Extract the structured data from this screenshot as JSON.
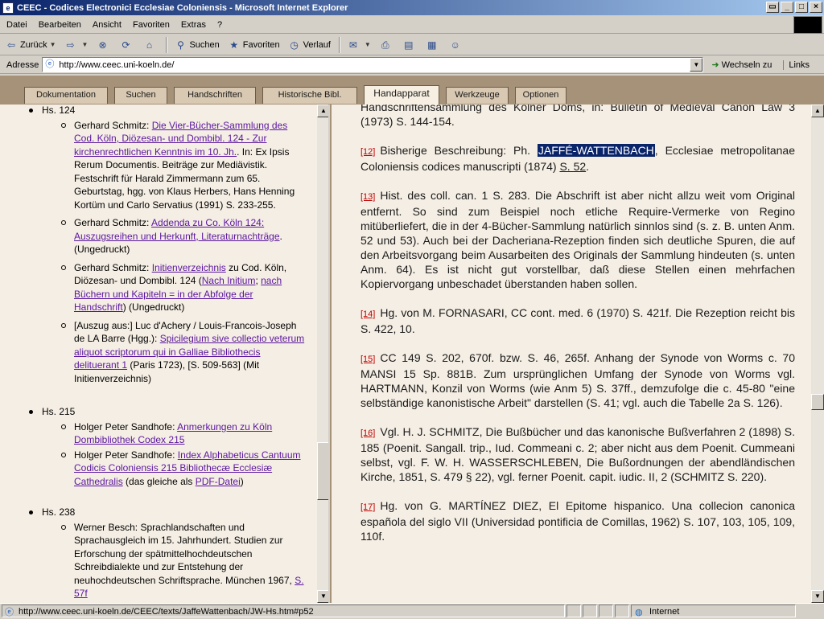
{
  "window": {
    "title": "CEEC - Codices Electronici Ecclesiae Coloniensis - Microsoft Internet Explorer"
  },
  "menu": [
    "Datei",
    "Bearbeiten",
    "Ansicht",
    "Favoriten",
    "Extras",
    "?"
  ],
  "toolbar": {
    "back": "Zurück",
    "search": "Suchen",
    "favorites": "Favoriten",
    "history": "Verlauf"
  },
  "address": {
    "label": "Adresse",
    "url": "http://www.ceec.uni-koeln.de/",
    "go": "Wechseln zu",
    "links": "Links"
  },
  "tabs": [
    "Dokumentation",
    "Suchen",
    "Handschriften",
    "Historische Bibl.",
    "Handapparat",
    "Werkzeuge",
    "Optionen"
  ],
  "active_tab": "Handapparat",
  "left": {
    "hs124": {
      "label": "Hs. 124",
      "e1": {
        "pre": "Gerhard Schmitz: ",
        "link": "Die Vier-Bücher-Sammlung des Cod. Köln, Diözesan- und Dombibl. 124 - Zur kirchenrechtlichen Kenntnis im 10. Jh.",
        "post": ". In: Ex Ipsis Rerum Documentis. Beiträge zur Mediävistik. Festschrift für Harald Zimmermann zum 65. Geburtstag, hgg. von Klaus Herbers, Hans Henning Kortüm und Carlo Servatius (1991) S. 233-255."
      },
      "e2": {
        "pre": "Gerhard Schmitz: ",
        "link": "Addenda zu Co. Köln 124: Auszugsreihen und Herkunft, Literaturnachträge",
        "post": ". (Ungedruckt)"
      },
      "e3": {
        "pre": "Gerhard Schmitz: ",
        "link": "Initienverzeichnis",
        "mid": " zu Cod. Köln, Diözesan- und Dombibl. 124 (",
        "link2": "Nach Initium",
        "sep": "; ",
        "link3": "nach Büchern und Kapiteln = in der Abfolge der Handschrift",
        "post": ") (Ungedruckt)"
      },
      "e4": {
        "pre": "[Auszug aus:] Luc d'Achery / Louis-Francois-Joseph de LA Barre (Hgg.): ",
        "link": "Spicilegium sive collectio veterum aliquot scriptorum qui in Galliae Bibliothecis delituerant 1",
        "post": " (Paris 1723), [S. 509-563] (Mit Initienverzeichnis)"
      }
    },
    "hs215": {
      "label": "Hs. 215",
      "e1": {
        "pre": "Holger Peter Sandhofe: ",
        "link": "Anmerkungen zu Köln Dombibliothek Codex 215"
      },
      "e2": {
        "pre": "Holger Peter Sandhofe: ",
        "link": "Index Alphabeticus Cantuum Codicis Coloniensis 215 Bibliothecæ Ecclesiæ Cathedralis",
        "mid": " (das gleiche als ",
        "link2": "PDF-Datei",
        "post": ")"
      }
    },
    "hs238": {
      "label": "Hs. 238",
      "e1": {
        "pre": "Werner Besch: Sprachlandschaften und Sprachausgleich im 15. Jahrhundert. Studien zur Erforschung der spätmittelhochdeutschen Schreibdialekte und zur Entstehung der neuhochdeutschen Schriftsprache. München 1967, ",
        "link": "S. 57f"
      }
    }
  },
  "right": {
    "top": "Handschriftensammlung des Kölner Doms, in: Bulletin of Medieval Canon Law 3 (1973) S. 144-154.",
    "fn12": {
      "num": "[12]",
      "pre": "Bisherige Beschreibung: Ph. ",
      "hl": "JAFFÉ-WATTENBACH",
      "post": ", Ecclesiae metropolitanae Coloniensis codices manuscripti (1874) ",
      "link": "S. 52",
      "end": "."
    },
    "fn13": {
      "num": "[13]",
      "text": "Hist. des coll. can. 1 S. 283. Die Abschrift ist aber nicht allzu weit vom Original entfernt. So sind zum Beispiel noch etliche Require-Vermerke von Regino mitüberliefert, die in der 4-Bücher-Sammlung natürlich sinnlos sind (s. z. B. unten Anm. 52 und 53). Auch bei der Dacheriana-Rezeption finden sich deutliche Spuren, die auf den Arbeitsvorgang beim Ausarbeiten des Originals der Sammlung hindeuten (s. unten Anm. 64). Es ist nicht gut vorstellbar, daß diese Stellen einen mehrfachen Kopiervorgang unbeschadet überstanden haben sollen."
    },
    "fn14": {
      "num": "[14]",
      "text": "Hg. von M. FORNASARI, CC cont. med. 6 (1970) S. 421f. Die Rezeption reicht bis S. 422, 10."
    },
    "fn15": {
      "num": "[15]",
      "text": "CC 149 S. 202, 670f. bzw. S. 46, 265f. Anhang der Synode von Worms c. 70 MANSI 15 Sp. 881B. Zum ursprünglichen Umfang der Synode von Worms vgl. HARTMANN, Konzil von Worms (wie Anm 5) S. 37ff., demzufolge die c. 45-80 \"eine selbständige kanonistische Arbeit\" darstellen (S. 41; vgl. auch die Tabelle 2a S. 126)."
    },
    "fn16": {
      "num": "[16]",
      "text": "Vgl. H. J. SCHMITZ, Die Bußbücher und das kanonische Bußverfahren 2 (1898) S. 185 (Poenit. Sangall. trip., Iud. Commeani c. 2; aber nicht aus dem Poenit. Cummeani selbst, vgl. F. W. H. WASSERSCHLEBEN, Die Bußordnungen der abendländischen Kirche, 1851, S. 479 § 22), vgl. ferner Poenit. capit. iudic. II, 2 (SCHMITZ S. 220)."
    },
    "fn17": {
      "num": "[17]",
      "text": "Hg. von G. MARTÍNEZ DIEZ, El Epitome hispanico. Una collecion canonica española del siglo VII (Universidad pontificia de Comillas, 1962) S. 107, 103, 105, 109, 110f."
    }
  },
  "status": {
    "url": "http://www.ceec.uni-koeln.de/CEEC/texts/JaffeWattenbach/JW-Hs.htm#p52",
    "zone": "Internet"
  }
}
